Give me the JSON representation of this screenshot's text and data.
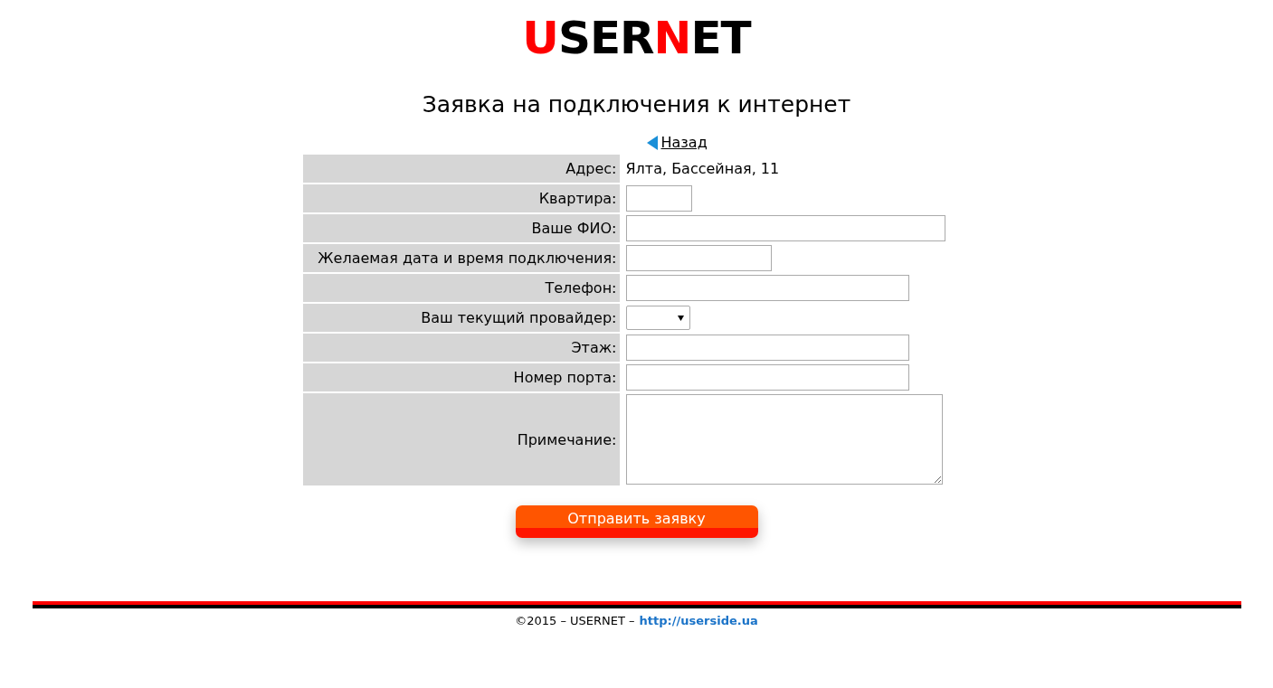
{
  "logo": [
    {
      "text": "U",
      "color": "#ff0000"
    },
    {
      "text": "SER",
      "color": "#000000"
    },
    {
      "text": "N",
      "color": "#ff0000"
    },
    {
      "text": "ET",
      "color": "#000000"
    }
  ],
  "title": "Заявка на подключения к интернет",
  "back_link": "Назад",
  "form": [
    {
      "label": "Адрес:",
      "kind": "text",
      "value": "Ялта, Бассейная, 11"
    },
    {
      "label": "Квартира:",
      "kind": "short"
    },
    {
      "label": "Ваше ФИО:",
      "kind": "long"
    },
    {
      "label": "Желаемая дата и время подключения:",
      "kind": "date"
    },
    {
      "label": "Телефон:",
      "kind": "medium"
    },
    {
      "label": "Ваш текущий провайдер:",
      "kind": "select"
    },
    {
      "label": "Этаж:",
      "kind": "medium"
    },
    {
      "label": "Номер порта:",
      "kind": "medium"
    },
    {
      "label": "Примечание:",
      "kind": "textarea"
    }
  ],
  "submit_button": "Отправить заявку",
  "footer": {
    "text": "©2015 – USERNET –",
    "link": "http://userside.ua"
  }
}
